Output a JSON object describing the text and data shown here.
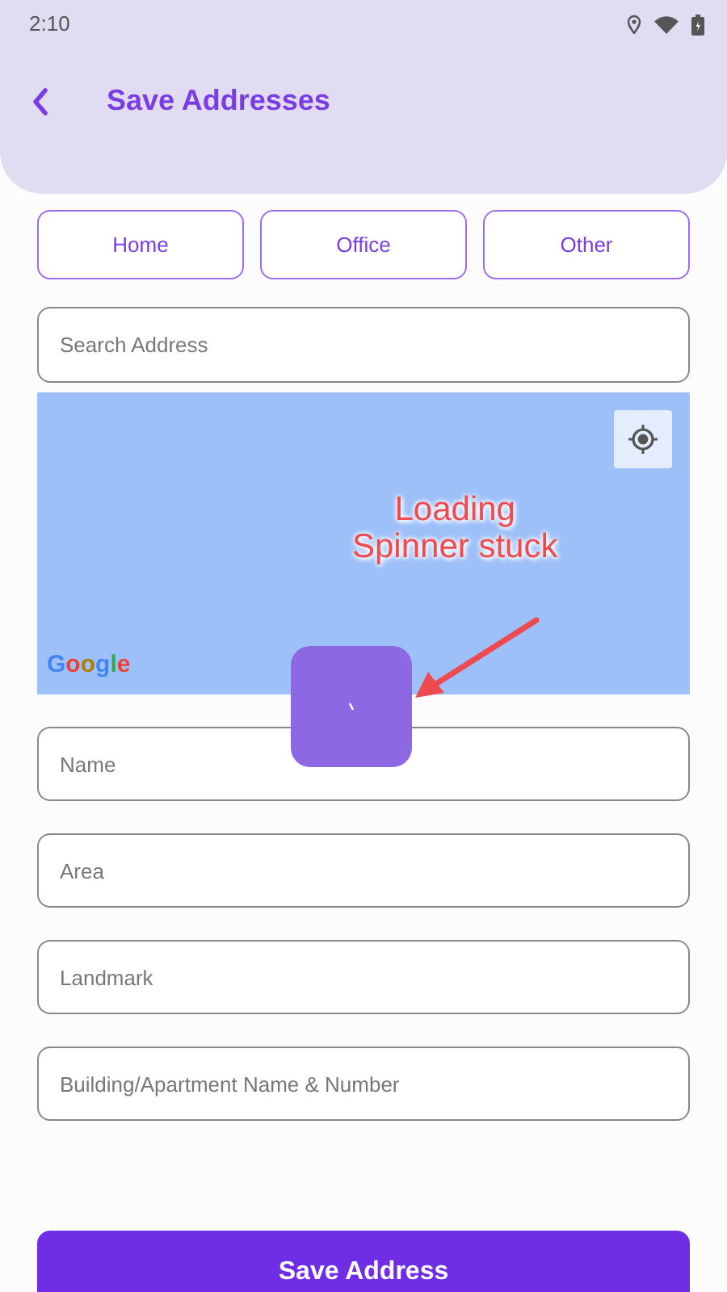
{
  "status_bar": {
    "time": "2:10"
  },
  "header": {
    "title": "Save Addresses"
  },
  "address_types": [
    {
      "label": "Home",
      "selected": false
    },
    {
      "label": "Office",
      "selected": false
    },
    {
      "label": "Other",
      "selected": false
    }
  ],
  "search": {
    "placeholder": "Search Address"
  },
  "map": {
    "attribution": "Google"
  },
  "fields": [
    {
      "placeholder": "Name"
    },
    {
      "placeholder": "Area"
    },
    {
      "placeholder": "Landmark"
    },
    {
      "placeholder": "Building/Apartment Name & Number"
    }
  ],
  "annotation": {
    "text": "Loading\nSpinner stuck"
  },
  "save_button": {
    "label": "Save Address"
  }
}
